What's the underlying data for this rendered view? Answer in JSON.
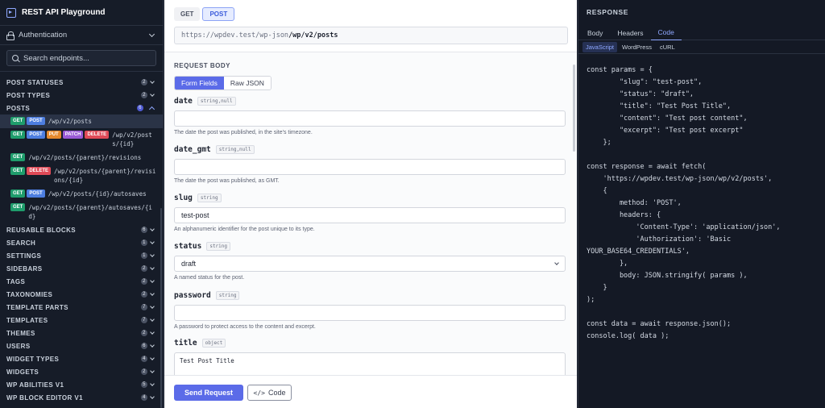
{
  "app": {
    "title": "REST API Playground"
  },
  "sidebar": {
    "auth_label": "Authentication",
    "search_placeholder": "Search endpoints...",
    "categories_top": [
      {
        "label": "POST STATUSES",
        "count": "2"
      },
      {
        "label": "POST TYPES",
        "count": "2"
      }
    ],
    "open_category": {
      "label": "POSTS",
      "count": "6"
    },
    "routes": [
      {
        "methods": [
          "GET",
          "POST"
        ],
        "path": "/wp/v2/posts",
        "active": true
      },
      {
        "methods": [
          "GET",
          "POST",
          "PUT",
          "PATCH",
          "DELETE"
        ],
        "path": "/wp/v2/posts/{id}"
      },
      {
        "methods": [
          "GET"
        ],
        "path": "/wp/v2/posts/{parent}/revisions"
      },
      {
        "methods": [
          "GET",
          "DELETE"
        ],
        "path": "/wp/v2/posts/{parent}/revisions/{id}"
      },
      {
        "methods": [
          "GET",
          "POST"
        ],
        "path": "/wp/v2/posts/{id}/autosaves"
      },
      {
        "methods": [
          "GET"
        ],
        "path": "/wp/v2/posts/{parent}/autosaves/{id}"
      }
    ],
    "categories_bottom": [
      {
        "label": "REUSABLE BLOCKS",
        "count": "6"
      },
      {
        "label": "SEARCH",
        "count": "1"
      },
      {
        "label": "SETTINGS",
        "count": "1"
      },
      {
        "label": "SIDEBARS",
        "count": "2"
      },
      {
        "label": "TAGS",
        "count": "2"
      },
      {
        "label": "TAXONOMIES",
        "count": "2"
      },
      {
        "label": "TEMPLATE PARTS",
        "count": "7"
      },
      {
        "label": "TEMPLATES",
        "count": "7"
      },
      {
        "label": "THEMES",
        "count": "2"
      },
      {
        "label": "USERS",
        "count": "6"
      },
      {
        "label": "WIDGET TYPES",
        "count": "4"
      },
      {
        "label": "WIDGETS",
        "count": "2"
      },
      {
        "label": "WP ABILITIES V1",
        "count": "5"
      },
      {
        "label": "WP BLOCK EDITOR V1",
        "count": "4"
      }
    ]
  },
  "request": {
    "methods": [
      {
        "label": "GET",
        "selected": false
      },
      {
        "label": "POST",
        "selected": true
      }
    ],
    "url_prefix": "https://wpdev.test/wp-json",
    "url_route": "/wp/v2/posts",
    "body_title": "REQUEST BODY",
    "modes": [
      {
        "label": "Form Fields",
        "selected": true
      },
      {
        "label": "Raw JSON",
        "selected": false
      }
    ],
    "fields": [
      {
        "name": "date",
        "type": "string,null",
        "value": "",
        "kind": "input",
        "desc": "The date the post was published, in the site's timezone."
      },
      {
        "name": "date_gmt",
        "type": "string,null",
        "value": "",
        "kind": "input",
        "desc": "The date the post was published, as GMT."
      },
      {
        "name": "slug",
        "type": "string",
        "value": "test-post",
        "kind": "input",
        "desc": "An alphanumeric identifier for the post unique to its type."
      },
      {
        "name": "status",
        "type": "string",
        "value": "draft",
        "kind": "select",
        "desc": "A named status for the post."
      },
      {
        "name": "password",
        "type": "string",
        "value": "",
        "kind": "input",
        "desc": "A password to protect access to the content and excerpt."
      },
      {
        "name": "title",
        "type": "object",
        "value": "Test Post Title",
        "kind": "textarea",
        "desc": ""
      }
    ],
    "send_label": "Send Request",
    "code_label": "Code",
    "code_icon": "</>"
  },
  "response": {
    "title": "RESPONSE",
    "tabs": [
      {
        "label": "Body",
        "selected": false
      },
      {
        "label": "Headers",
        "selected": false
      },
      {
        "label": "Code",
        "selected": true
      }
    ],
    "langs": [
      {
        "label": "JavaScript",
        "selected": true
      },
      {
        "label": "WordPress",
        "selected": false
      },
      {
        "label": "cURL",
        "selected": false
      }
    ],
    "code": "const params = {\n        \"slug\": \"test-post\",\n        \"status\": \"draft\",\n        \"title\": \"Test Post Title\",\n        \"content\": \"Test post content\",\n        \"excerpt\": \"Test post excerpt\"\n    };\n\nconst response = await fetch(\n    'https://wpdev.test/wp-json/wp/v2/posts',\n    {\n        method: 'POST',\n        headers: {\n            'Content-Type': 'application/json',\n            'Authorization': 'Basic\nYOUR_BASE64_CREDENTIALS',\n        },\n        body: JSON.stringify( params ),\n    }\n);\n\nconst data = await response.json();\nconsole.log( data );"
  }
}
